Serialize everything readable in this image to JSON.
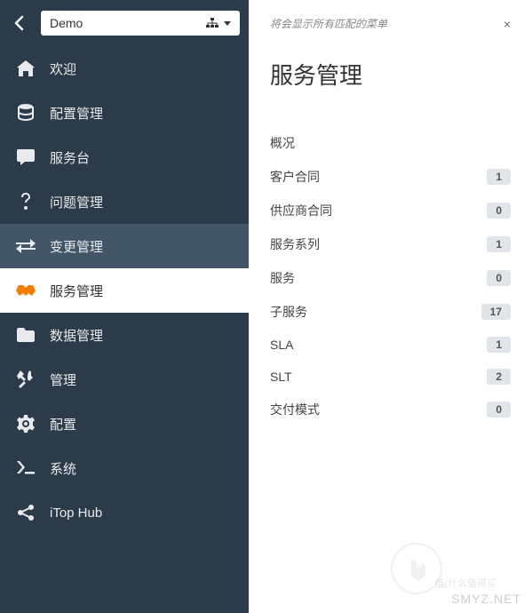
{
  "sidebar": {
    "org_value": "Demo",
    "items": [
      {
        "id": "welcome",
        "label": "欢迎",
        "icon": "home"
      },
      {
        "id": "config",
        "label": "配置管理",
        "icon": "database"
      },
      {
        "id": "helpdesk",
        "label": "服务台",
        "icon": "chat"
      },
      {
        "id": "problem",
        "label": "问题管理",
        "icon": "question"
      },
      {
        "id": "change",
        "label": "变更管理",
        "icon": "exchange",
        "highlighted": true
      },
      {
        "id": "service",
        "label": "服务管理",
        "icon": "handshake",
        "active": true
      },
      {
        "id": "data",
        "label": "数据管理",
        "icon": "folder"
      },
      {
        "id": "admin",
        "label": "管理",
        "icon": "tools"
      },
      {
        "id": "settings",
        "label": "配置",
        "icon": "gear"
      },
      {
        "id": "system",
        "label": "系统",
        "icon": "terminal"
      },
      {
        "id": "hub",
        "label": "iTop Hub",
        "icon": "share"
      }
    ]
  },
  "main": {
    "hint": "将会显示所有匹配的菜单",
    "title": "服务管理",
    "links": [
      {
        "label": "概况",
        "count": null
      },
      {
        "label": "客户合同",
        "count": "1"
      },
      {
        "label": "供应商合同",
        "count": "0"
      },
      {
        "label": "服务系列",
        "count": "1"
      },
      {
        "label": "服务",
        "count": "0"
      },
      {
        "label": "子服务",
        "count": "17"
      },
      {
        "label": "SLA",
        "count": "1"
      },
      {
        "label": "SLT",
        "count": "2"
      },
      {
        "label": "交付模式",
        "count": "0"
      }
    ],
    "watermark": "SMYZ.NET",
    "watermark_sub": "值(什么值得买"
  }
}
